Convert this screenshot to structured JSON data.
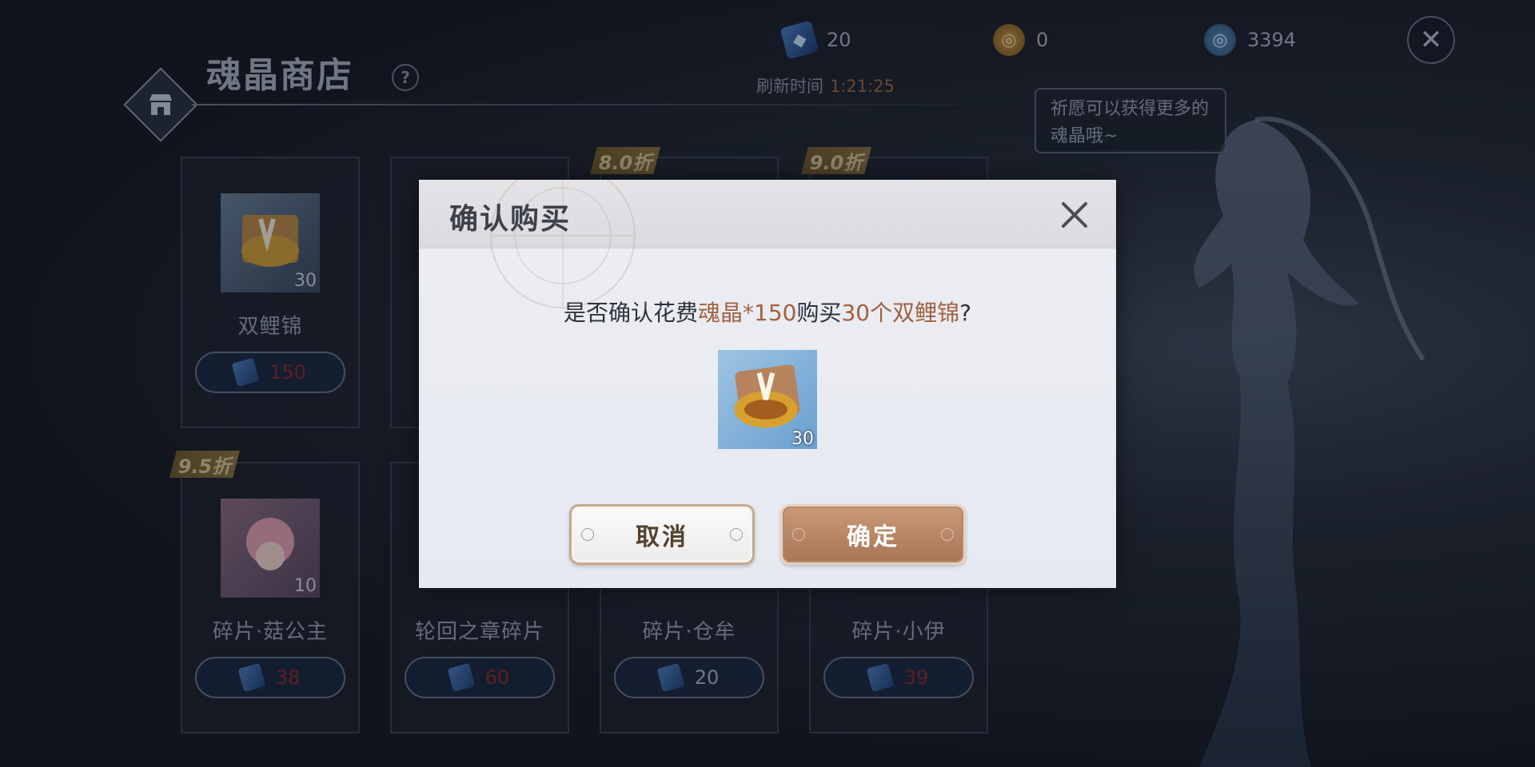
{
  "header": {
    "store_title": "魂晶商店",
    "help_label": "?",
    "refresh_label": "刷新时间",
    "refresh_timer": "1:21:25",
    "close_label": "✕"
  },
  "currencies": [
    {
      "icon": "soul-crystal-icon",
      "value": "20"
    },
    {
      "icon": "coin-icon",
      "value": "0"
    },
    {
      "icon": "shell-currency-icon",
      "value": "3394"
    }
  ],
  "speech_bubble": "祈愿可以获得更多的魂晶哦~",
  "shop_items": [
    {
      "name": "双鲤锦",
      "qty": "30",
      "price": "150",
      "discount": ""
    },
    {
      "name": "碎片·菇公主",
      "qty": "10",
      "price": "38",
      "discount": "9.5折"
    },
    {
      "name": "轮回之章碎片",
      "qty": "",
      "price": "60",
      "discount": ""
    },
    {
      "name": "碎片·仓牟",
      "qty": "",
      "price": "20",
      "discount": "8.0折"
    },
    {
      "name": "碎片·小伊",
      "qty": "",
      "price": "39",
      "discount": "9.0折"
    }
  ],
  "dialog": {
    "title": "确认购买",
    "msg_prefix": "是否确认花费",
    "msg_cost": "魂晶*150",
    "msg_mid": "购买",
    "msg_item": "30个双鲤锦",
    "msg_suffix": "?",
    "item_qty": "30",
    "cancel_label": "取消",
    "confirm_label": "确定"
  },
  "colors": {
    "accent_brown": "#a2613d",
    "confirm_button": "#b9896a",
    "price_red": "#8e2a2a"
  }
}
